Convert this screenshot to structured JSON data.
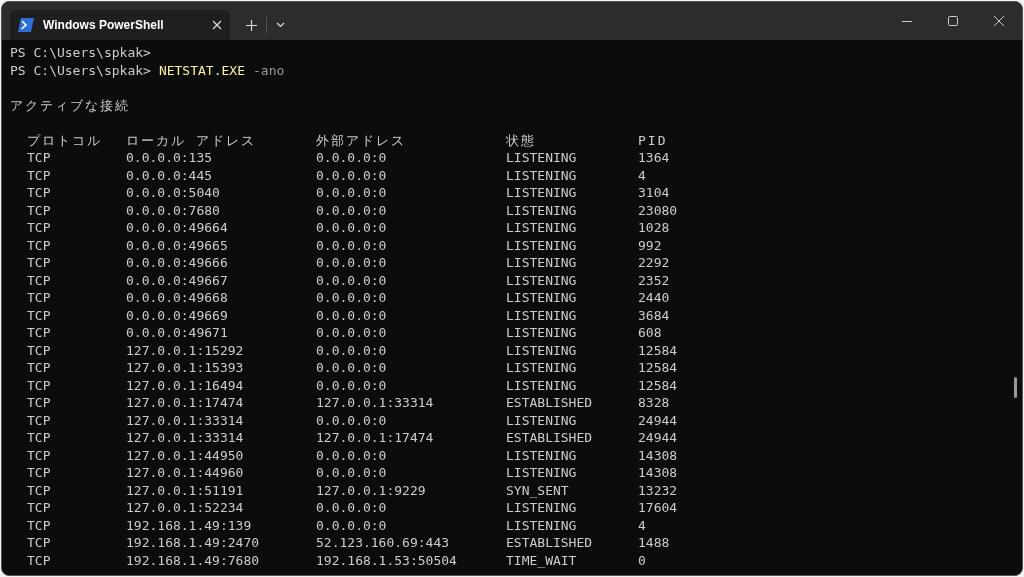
{
  "window": {
    "tab_title": "Windows PowerShell"
  },
  "terminal": {
    "prompt_lines": [
      {
        "prompt": "PS C:\\Users\\spkak>"
      },
      {
        "prompt": "PS C:\\Users\\spkak>",
        "command": "NETSTAT.EXE",
        "args": "-ano"
      }
    ],
    "heading": "アクティブな接続",
    "columns": [
      "プロトコル",
      "ローカル アドレス",
      "外部アドレス",
      "状態",
      "PID"
    ],
    "rows": [
      [
        "TCP",
        "0.0.0.0:135",
        "0.0.0.0:0",
        "LISTENING",
        "1364"
      ],
      [
        "TCP",
        "0.0.0.0:445",
        "0.0.0.0:0",
        "LISTENING",
        "4"
      ],
      [
        "TCP",
        "0.0.0.0:5040",
        "0.0.0.0:0",
        "LISTENING",
        "3104"
      ],
      [
        "TCP",
        "0.0.0.0:7680",
        "0.0.0.0:0",
        "LISTENING",
        "23080"
      ],
      [
        "TCP",
        "0.0.0.0:49664",
        "0.0.0.0:0",
        "LISTENING",
        "1028"
      ],
      [
        "TCP",
        "0.0.0.0:49665",
        "0.0.0.0:0",
        "LISTENING",
        "992"
      ],
      [
        "TCP",
        "0.0.0.0:49666",
        "0.0.0.0:0",
        "LISTENING",
        "2292"
      ],
      [
        "TCP",
        "0.0.0.0:49667",
        "0.0.0.0:0",
        "LISTENING",
        "2352"
      ],
      [
        "TCP",
        "0.0.0.0:49668",
        "0.0.0.0:0",
        "LISTENING",
        "2440"
      ],
      [
        "TCP",
        "0.0.0.0:49669",
        "0.0.0.0:0",
        "LISTENING",
        "3684"
      ],
      [
        "TCP",
        "0.0.0.0:49671",
        "0.0.0.0:0",
        "LISTENING",
        "608"
      ],
      [
        "TCP",
        "127.0.0.1:15292",
        "0.0.0.0:0",
        "LISTENING",
        "12584"
      ],
      [
        "TCP",
        "127.0.0.1:15393",
        "0.0.0.0:0",
        "LISTENING",
        "12584"
      ],
      [
        "TCP",
        "127.0.0.1:16494",
        "0.0.0.0:0",
        "LISTENING",
        "12584"
      ],
      [
        "TCP",
        "127.0.0.1:17474",
        "127.0.0.1:33314",
        "ESTABLISHED",
        "8328"
      ],
      [
        "TCP",
        "127.0.0.1:33314",
        "0.0.0.0:0",
        "LISTENING",
        "24944"
      ],
      [
        "TCP",
        "127.0.0.1:33314",
        "127.0.0.1:17474",
        "ESTABLISHED",
        "24944"
      ],
      [
        "TCP",
        "127.0.0.1:44950",
        "0.0.0.0:0",
        "LISTENING",
        "14308"
      ],
      [
        "TCP",
        "127.0.0.1:44960",
        "0.0.0.0:0",
        "LISTENING",
        "14308"
      ],
      [
        "TCP",
        "127.0.0.1:51191",
        "127.0.0.1:9229",
        "SYN_SENT",
        "13232"
      ],
      [
        "TCP",
        "127.0.0.1:52234",
        "0.0.0.0:0",
        "LISTENING",
        "17604"
      ],
      [
        "TCP",
        "192.168.1.49:139",
        "0.0.0.0:0",
        "LISTENING",
        "4"
      ],
      [
        "TCP",
        "192.168.1.49:2470",
        "52.123.160.69:443",
        "ESTABLISHED",
        "1488"
      ],
      [
        "TCP",
        "192.168.1.49:7680",
        "192.168.1.53:50504",
        "TIME_WAIT",
        "0"
      ]
    ]
  }
}
